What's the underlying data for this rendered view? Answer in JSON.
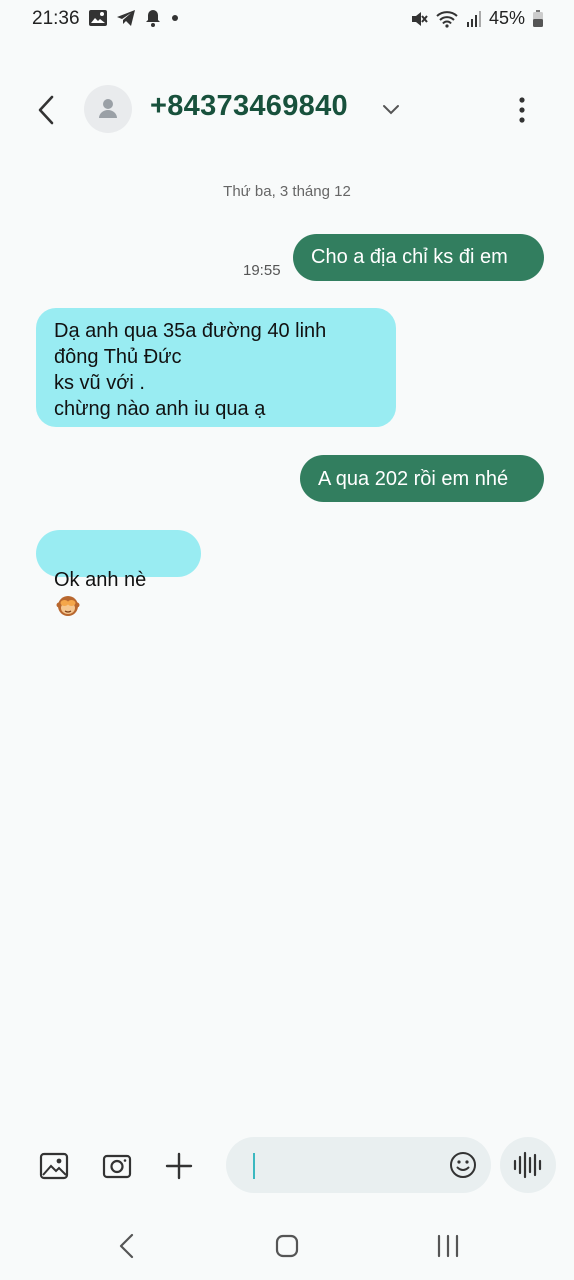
{
  "status_bar": {
    "time": "21:36",
    "battery": "45%"
  },
  "header": {
    "contact": "+84373469840"
  },
  "conversation": {
    "date": "Thứ ba, 3 tháng 12",
    "messages": [
      {
        "direction": "outgoing",
        "text": "Cho a địa chỉ ks đi em",
        "time": "19:55"
      },
      {
        "direction": "incoming",
        "text": "Dạ anh qua 35a đường 40 linh\nđông Thủ Đức\n ks vũ với .\n chừng nào anh iu qua ạ"
      },
      {
        "direction": "outgoing",
        "text": "A qua 202 rồi em nhé"
      },
      {
        "direction": "incoming",
        "text": "Ok anh nè",
        "emoji": "see-no-evil-monkey"
      }
    ]
  },
  "composer": {
    "placeholder": "",
    "buttons": [
      "gallery-icon",
      "camera-icon",
      "add-icon",
      "emoji-icon",
      "voice-icon"
    ]
  },
  "colors": {
    "outgoing_bubble": "#327e5f",
    "incoming_bubble": "#99ecf2",
    "contact_name": "#18513c",
    "background": "#f8fafa"
  }
}
